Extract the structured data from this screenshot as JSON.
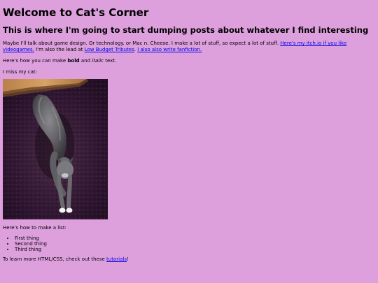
{
  "page": {
    "heading": "Welcome to Cat's Corner",
    "subheading": "This is where I'm going to start dumping posts about whatever I find interesting"
  },
  "intro": {
    "text_before": "Maybe I'll talk about game design. Or technology. or Mac n. Cheese. I make a lot of stuff, so expect a lot of stuff. ",
    "itch_link": "Here's my itch.io if you like videogames.",
    "text_lead": "I'm also the lead at ",
    "tributes_link": "Low Budget Tributes",
    "text_comma": ". ",
    "fanfic_link": "I also also write fanfiction."
  },
  "formatting": {
    "prefix": "Here's how you can make ",
    "bold_word": "bold",
    "middle": " and ",
    "italic_word": "italic",
    "suffix": " text."
  },
  "cat": {
    "caption": "I miss my cat:"
  },
  "list_section": {
    "intro": "Here's how to make a list:",
    "items": [
      "First thing",
      "Second thing",
      "Third thing"
    ]
  },
  "learn_more": {
    "prefix": "To learn more HTML/CSS, check out these ",
    "link": "tutorials",
    "suffix": "!"
  },
  "colors": {
    "background": "#dda0dd",
    "link": "#0000ee"
  }
}
